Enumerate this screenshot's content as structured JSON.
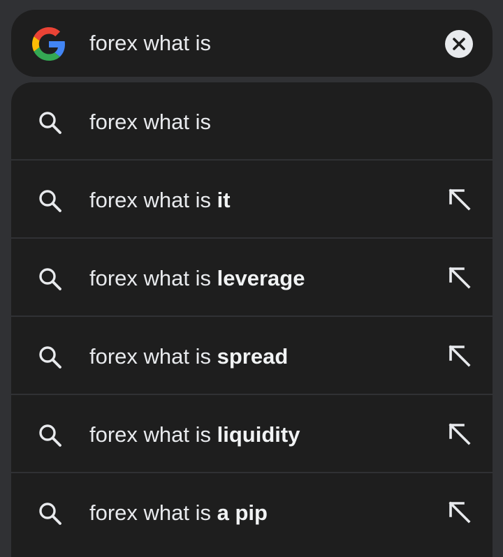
{
  "search": {
    "query": "forex what is",
    "logo_icon": "google-g-icon",
    "clear_icon": "close-circle-icon"
  },
  "suggestions": [
    {
      "base": "forex what is",
      "completion": "",
      "has_arrow": false
    },
    {
      "base": "forex what is ",
      "completion": "it",
      "has_arrow": true
    },
    {
      "base": "forex what is ",
      "completion": "leverage",
      "has_arrow": true
    },
    {
      "base": "forex what is ",
      "completion": "spread",
      "has_arrow": true
    },
    {
      "base": "forex what is ",
      "completion": "liquidity",
      "has_arrow": true
    },
    {
      "base": "forex what is ",
      "completion": "a pip",
      "has_arrow": true
    }
  ],
  "icons": {
    "row_icon": "search-icon",
    "fill_icon": "arrow-up-left-icon"
  },
  "colors": {
    "background": "#303134",
    "surface": "#1e1e1e",
    "text": "#e8eaed",
    "google_blue": "#4285F4",
    "google_red": "#EA4335",
    "google_yellow": "#FBBC05",
    "google_green": "#34A853"
  }
}
